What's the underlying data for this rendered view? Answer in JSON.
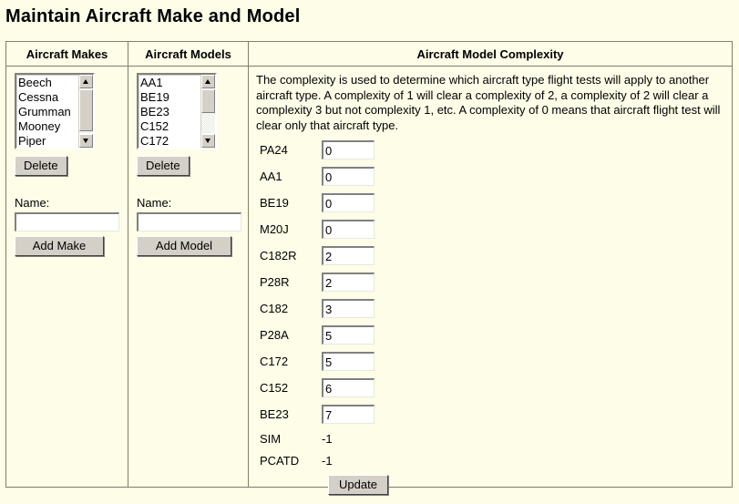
{
  "page": {
    "title": "Maintain Aircraft Make and Model",
    "background_color": "#fdfde8",
    "border_color": "#808068"
  },
  "columns": {
    "makes": {
      "header": "Aircraft Makes",
      "listbox": {
        "items": [
          "Beech",
          "Cessna",
          "Grumman",
          "Mooney",
          "Piper"
        ],
        "scroll_up_icon": "scroll-up-arrow-icon",
        "scroll_down_icon": "scroll-down-arrow-icon"
      },
      "delete_label": "Delete",
      "name_label": "Name:",
      "name_value": "",
      "name_placeholder": "",
      "add_label": "Add Make"
    },
    "models": {
      "header": "Aircraft Models",
      "listbox": {
        "items": [
          "AA1",
          "BE19",
          "BE23",
          "C152",
          "C172"
        ],
        "scroll_up_icon": "scroll-up-arrow-icon",
        "scroll_down_icon": "scroll-down-arrow-icon"
      },
      "delete_label": "Delete",
      "name_label": "Name:",
      "name_value": "",
      "name_placeholder": "",
      "add_label": "Add Model"
    },
    "complexity": {
      "header": "Aircraft Model Complexity",
      "intro": "The complexity is used to determine which aircraft type flight tests will apply to another aircraft type. A complexity of 1 will clear a complexity of 2, a complexity of 2 will clear a complexity 3 but not complexity 1, etc. A complexity of 0 means that aircraft flight test will clear only that aircraft type.",
      "rows": [
        {
          "label": "PA24",
          "value": "0",
          "editable": true
        },
        {
          "label": "AA1",
          "value": "0",
          "editable": true
        },
        {
          "label": "BE19",
          "value": "0",
          "editable": true
        },
        {
          "label": "M20J",
          "value": "0",
          "editable": true
        },
        {
          "label": "C182R",
          "value": "2",
          "editable": true
        },
        {
          "label": "P28R",
          "value": "2",
          "editable": true
        },
        {
          "label": "C182",
          "value": "3",
          "editable": true
        },
        {
          "label": "P28A",
          "value": "5",
          "editable": true
        },
        {
          "label": "C172",
          "value": "5",
          "editable": true
        },
        {
          "label": "C152",
          "value": "6",
          "editable": true
        },
        {
          "label": "BE23",
          "value": "7",
          "editable": true
        },
        {
          "label": "SIM",
          "value": "-1",
          "editable": false
        },
        {
          "label": "PCATD",
          "value": "-1",
          "editable": false
        }
      ],
      "update_label": "Update"
    }
  }
}
